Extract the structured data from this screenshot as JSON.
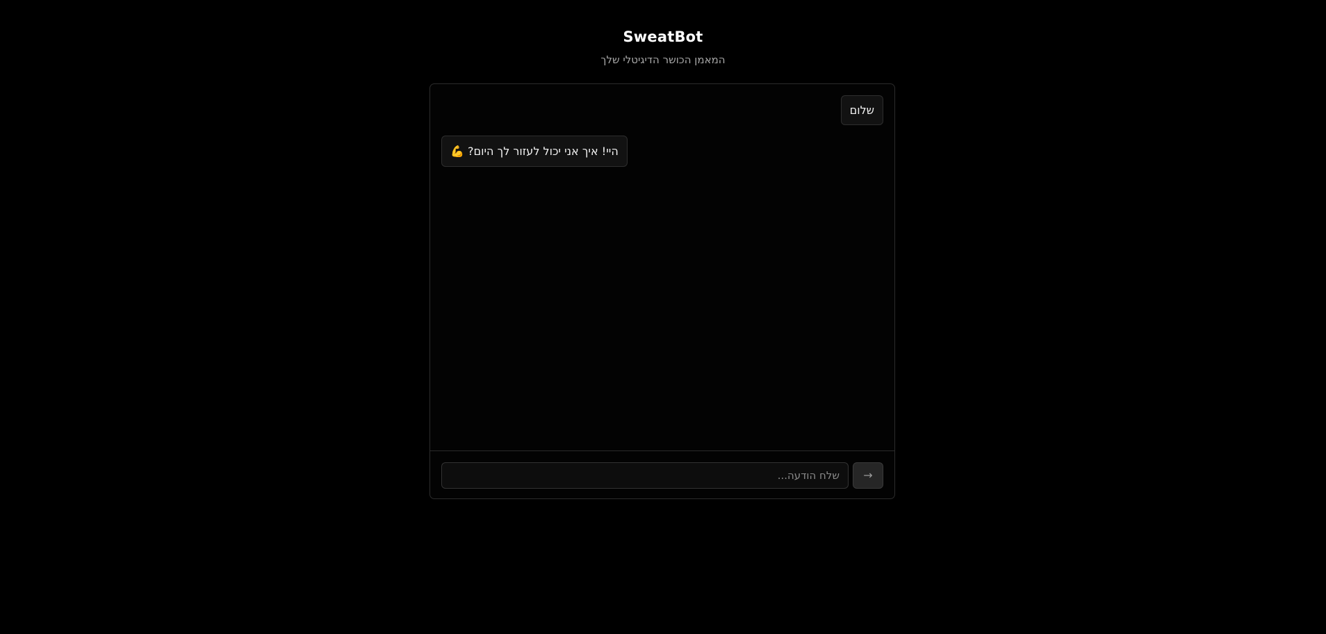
{
  "header": {
    "title": "SweatBot",
    "subtitle": "המאמן הכושר הדיגיטלי שלך"
  },
  "chat": {
    "messages": [
      {
        "role": "user",
        "text": "שלום"
      },
      {
        "role": "bot",
        "text": "היי! איך אני יכול לעזור לך היום? 💪"
      }
    ],
    "input": {
      "value": "",
      "placeholder": "שלח הודעה..."
    },
    "send": {
      "label": "→",
      "icon": "arrow-right-icon"
    }
  },
  "colors": {
    "background": "#000000",
    "panel_border": "#2c2c2c",
    "bubble_bg": "#121212",
    "text": "#f2f2f2",
    "muted_text": "#a8a8a8"
  }
}
